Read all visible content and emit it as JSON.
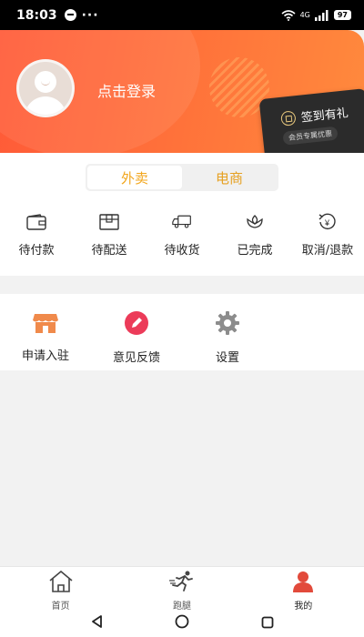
{
  "status_bar": {
    "time": "18:03",
    "dots": "···",
    "battery": "97",
    "signal": "4G"
  },
  "header": {
    "login_text": "点击登录",
    "sign_title": "签到有礼",
    "sign_subtitle": "会员专属优惠"
  },
  "tabs": [
    {
      "label": "外卖"
    },
    {
      "label": "电商"
    }
  ],
  "orders": [
    {
      "label": "待付款",
      "icon": "wallet-icon"
    },
    {
      "label": "待配送",
      "icon": "box-icon"
    },
    {
      "label": "待收货",
      "icon": "truck-icon"
    },
    {
      "label": "已完成",
      "icon": "flower-icon"
    },
    {
      "label": "取消/退款",
      "icon": "refund-icon"
    }
  ],
  "tools": [
    {
      "label": "申请入驻",
      "icon": "shop-icon",
      "color": "#f08a4b"
    },
    {
      "label": "意见反馈",
      "icon": "pencil-icon",
      "color": "#ec3b59"
    },
    {
      "label": "设置",
      "icon": "gear-icon",
      "color": "#8c8c8c"
    }
  ],
  "bottom_nav": [
    {
      "label": "首页",
      "icon": "home-icon"
    },
    {
      "label": "跑腿",
      "icon": "runner-icon"
    },
    {
      "label": "我的",
      "icon": "profile-icon"
    }
  ],
  "colors": {
    "accent_orange": "#ff6a3a",
    "tab_active": "#f2a61c",
    "profile_active": "#e24a3b"
  }
}
